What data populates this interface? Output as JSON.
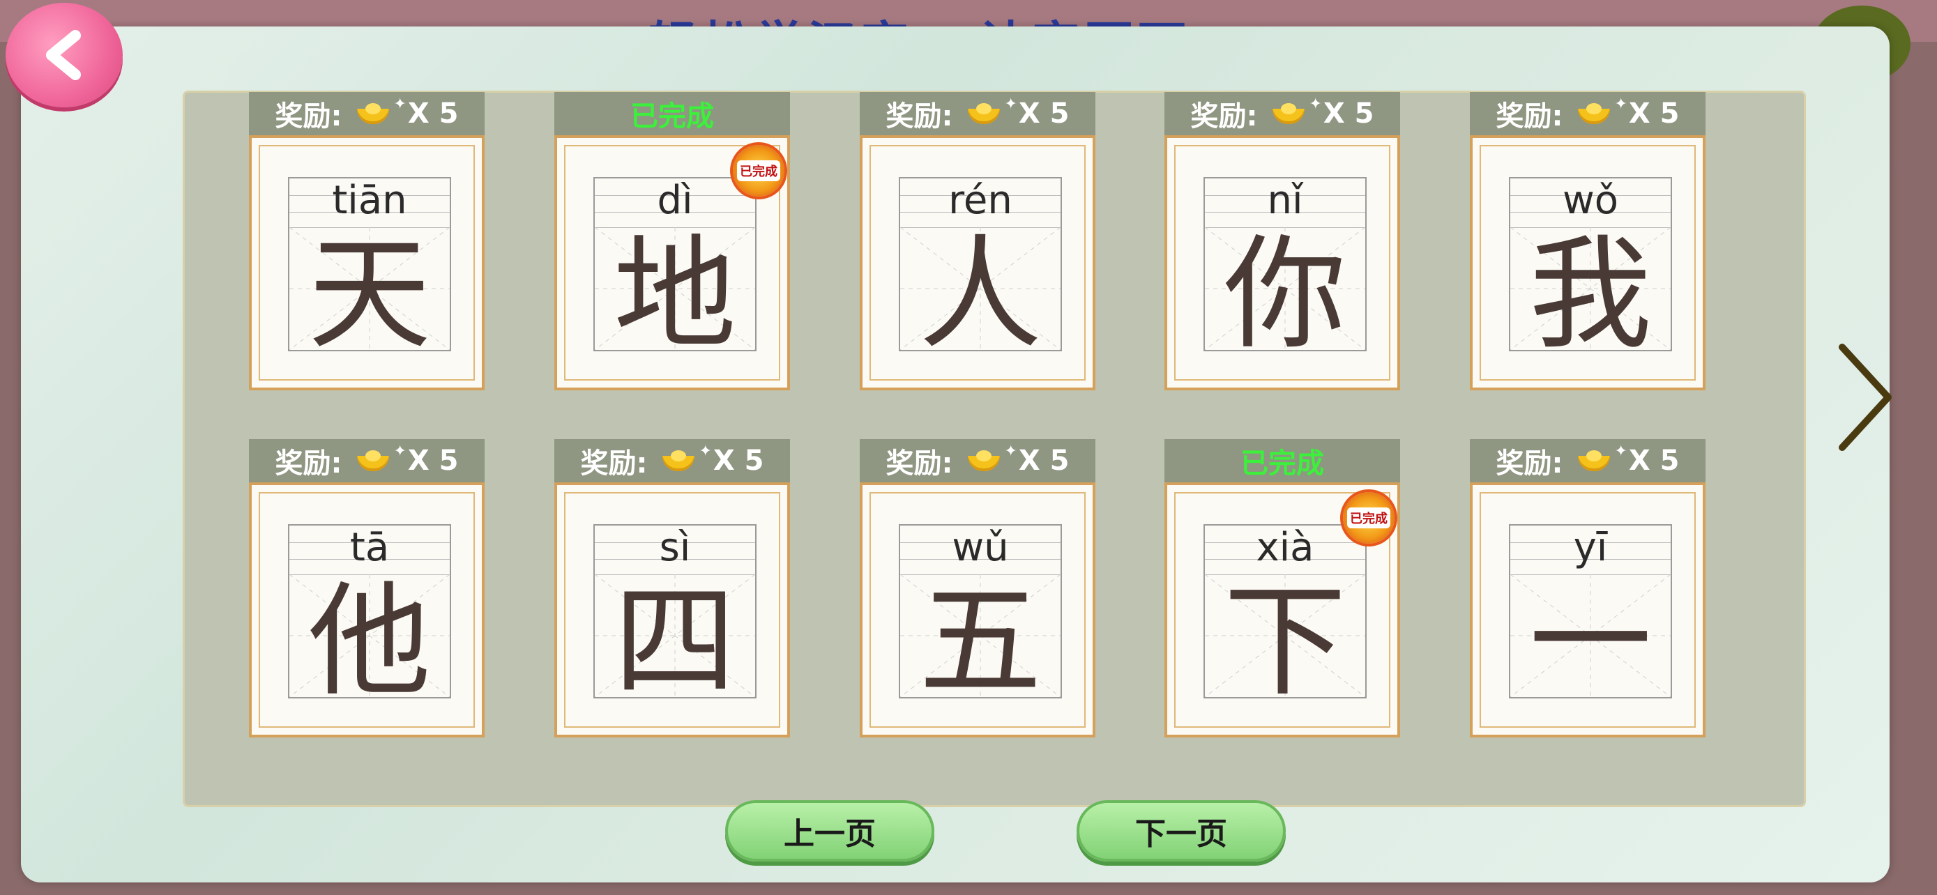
{
  "topbar": {
    "title": "轻松学汉字 · 认字页面"
  },
  "reward_label": "奖励:",
  "reward_multiplier": "X 5",
  "completed_label": "已完成",
  "stamp_text": "已完成",
  "cards": [
    {
      "pinyin": "tiān",
      "char": "天",
      "done": false
    },
    {
      "pinyin": "dì",
      "char": "地",
      "done": true
    },
    {
      "pinyin": "rén",
      "char": "人",
      "done": false
    },
    {
      "pinyin": "nǐ",
      "char": "你",
      "done": false
    },
    {
      "pinyin": "wǒ",
      "char": "我",
      "done": false
    },
    {
      "pinyin": "tā",
      "char": "他",
      "done": false
    },
    {
      "pinyin": "sì",
      "char": "四",
      "done": false
    },
    {
      "pinyin": "wǔ",
      "char": "五",
      "done": false
    },
    {
      "pinyin": "xià",
      "char": "下",
      "done": true
    },
    {
      "pinyin": "yī",
      "char": "一",
      "done": false
    }
  ],
  "pagination": {
    "prev_label": "上一页",
    "next_label": "下一页"
  },
  "colors": {
    "card_header": "#8f9682",
    "completed_text": "#3cf03c",
    "coin": "#f4c21a",
    "back_button": "#f0669a",
    "page_button": "#82d276"
  },
  "icons": {
    "back": "chevron-left-icon",
    "next": "chevron-right-icon",
    "reward": "gold-ingot-icon",
    "completed": "completed-stamp-icon"
  }
}
